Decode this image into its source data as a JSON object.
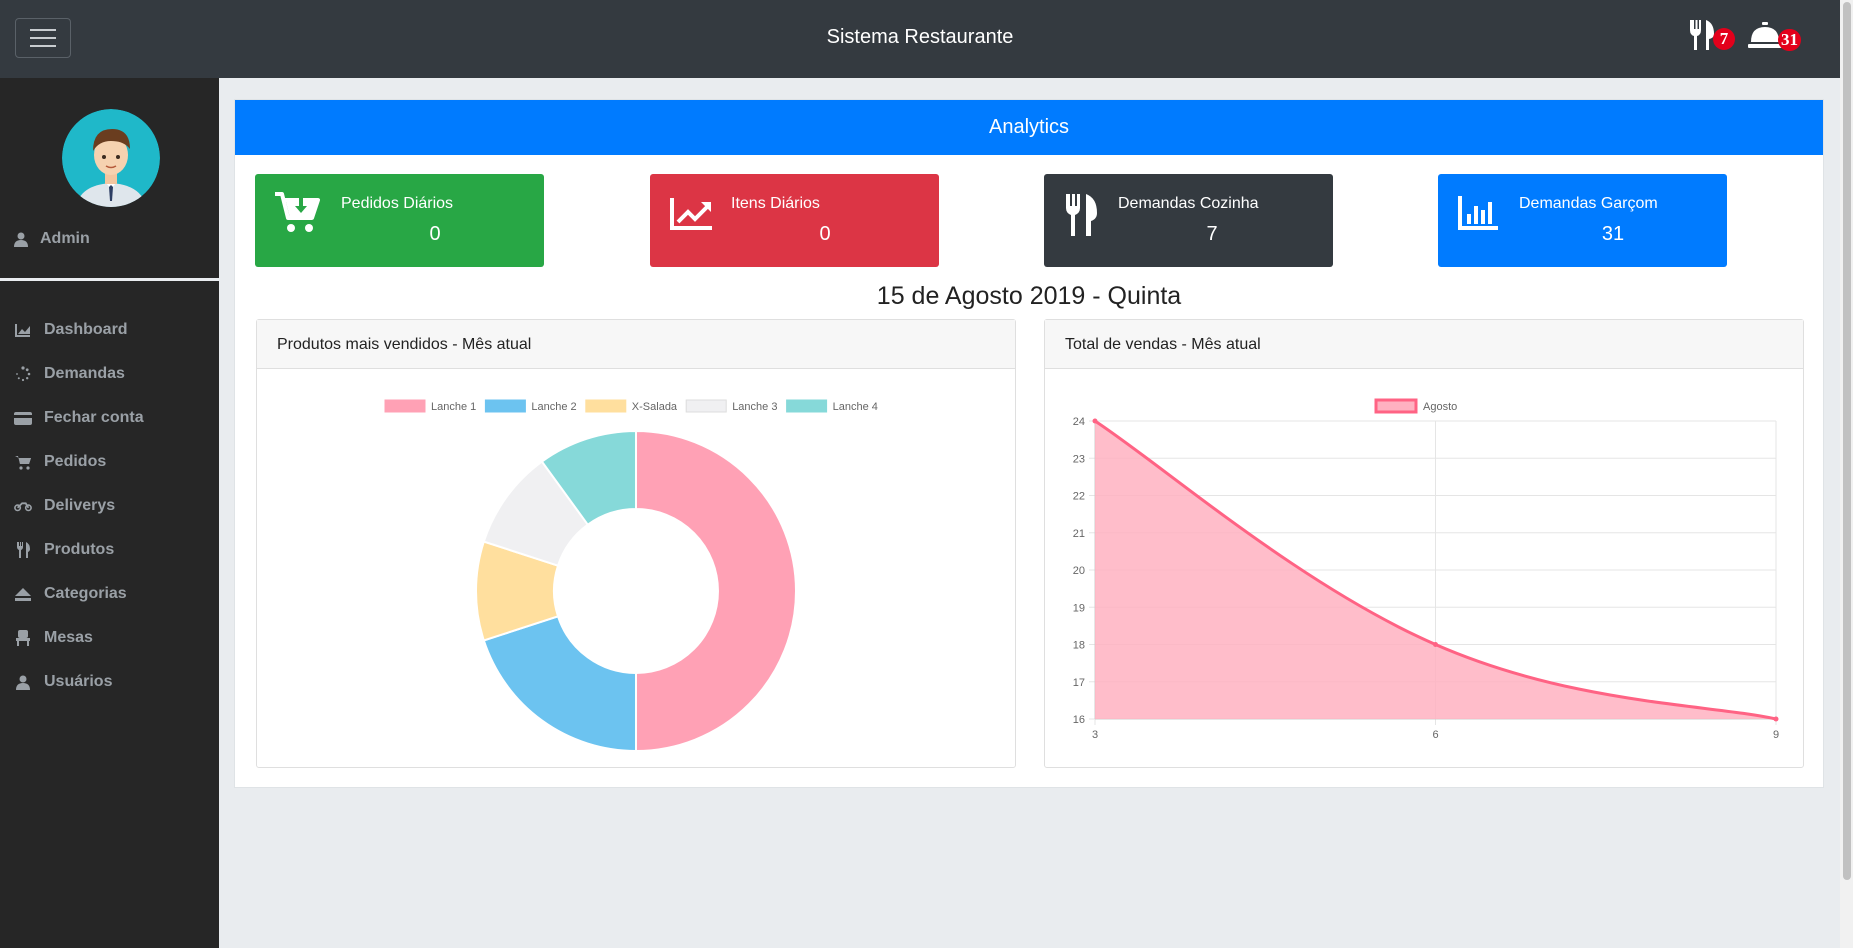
{
  "header": {
    "title": "Sistema Restaurante",
    "kitchen_count": "7",
    "waiter_count": "31"
  },
  "sidebar": {
    "user_name": "Admin",
    "items": [
      {
        "label": "Dashboard",
        "icon": "area-chart-icon"
      },
      {
        "label": "Demandas",
        "icon": "spinner-icon"
      },
      {
        "label": "Fechar conta",
        "icon": "credit-card-icon"
      },
      {
        "label": "Pedidos",
        "icon": "cart-icon"
      },
      {
        "label": "Deliverys",
        "icon": "motorcycle-icon"
      },
      {
        "label": "Produtos",
        "icon": "cutlery-icon"
      },
      {
        "label": "Categorias",
        "icon": "eject-icon"
      },
      {
        "label": "Mesas",
        "icon": "chair-icon"
      },
      {
        "label": "Usuários",
        "icon": "user-icon"
      }
    ]
  },
  "main": {
    "title": "Analytics",
    "stats": [
      {
        "label": "Pedidos Diários",
        "value": "0",
        "color": "#28a745",
        "icon": "cart-download-icon"
      },
      {
        "label": "Itens Diários",
        "value": "0",
        "color": "#dc3545",
        "icon": "line-chart-icon"
      },
      {
        "label": "Demandas Cozinha",
        "value": "7",
        "color": "#343a40",
        "icon": "cutlery-icon"
      },
      {
        "label": "Demandas Garçom",
        "value": "31",
        "color": "#007bff",
        "icon": "bar-chart-icon"
      }
    ],
    "date": "15 de Agosto 2019 - Quinta",
    "chart_left_title": "Produtos mais vendidos - Mês atual",
    "chart_right_title": "Total de vendas - Mês atual"
  },
  "chart_data": [
    {
      "type": "pie",
      "subtype": "doughnut",
      "labels": [
        "Lanche 1",
        "Lanche 2",
        "X-Salada",
        "Lanche 3",
        "Lanche 4"
      ],
      "values": [
        50,
        20,
        10,
        10,
        10
      ],
      "colors": [
        "#ffa1b5",
        "#6cc3f0",
        "#ffdf9e",
        "#f0f0f2",
        "#86d9d9"
      ],
      "legend": "top"
    },
    {
      "type": "area",
      "x": [
        3,
        6,
        9
      ],
      "series": [
        {
          "name": "Agosto",
          "values": [
            24,
            18,
            16
          ]
        }
      ],
      "ylim": [
        16,
        24
      ],
      "yticks": [
        16,
        17,
        18,
        19,
        20,
        21,
        22,
        23,
        24
      ],
      "xticks": [
        3,
        6,
        9
      ],
      "grid": true,
      "line_color": "#ff6384",
      "fill_color": "#ffb1c1",
      "legend": "top"
    }
  ]
}
